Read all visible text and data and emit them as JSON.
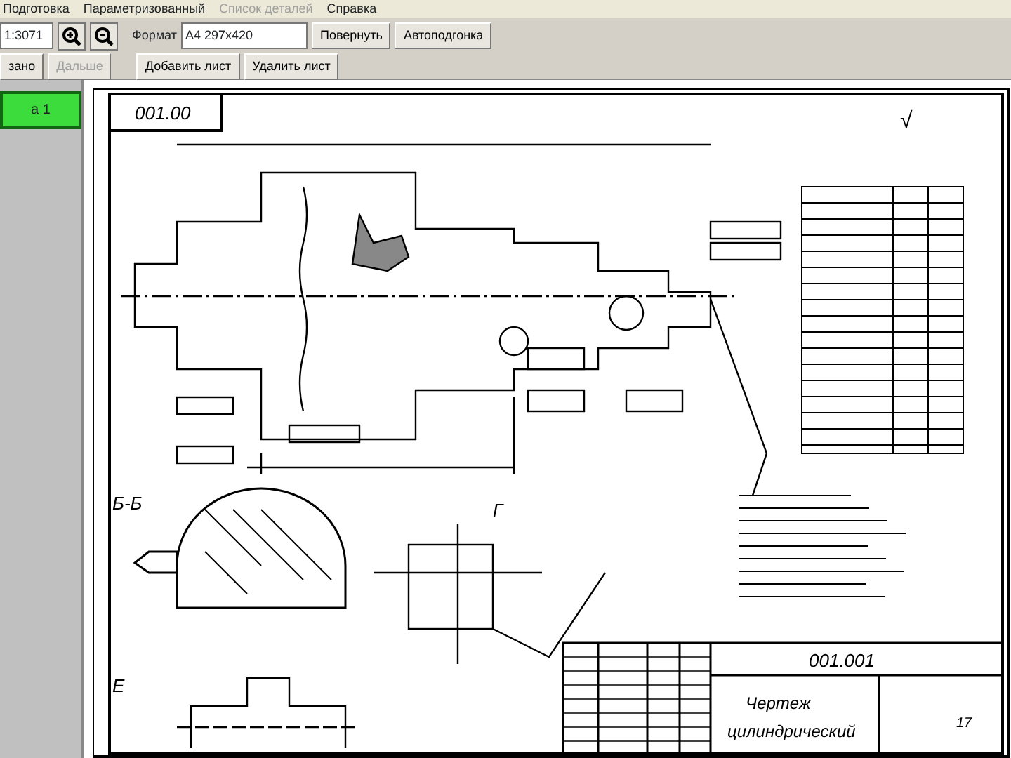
{
  "menu": [
    {
      "label": "Подготовка",
      "disabled": false
    },
    {
      "label": "Параметризованный",
      "disabled": false
    },
    {
      "label": "Список деталей",
      "disabled": true
    },
    {
      "label": "Справка",
      "disabled": false
    }
  ],
  "toolbar": {
    "scale": "1:3071",
    "format_label": "Формат",
    "format_value": "А4 297x420",
    "buttons_row1": [
      {
        "label": "Повернуть",
        "disabled": false
      },
      {
        "label": "Автоподгонка",
        "disabled": false
      }
    ],
    "buttons_row0": [
      {
        "label": "зано",
        "disabled": false
      },
      {
        "label": "Дальше",
        "disabled": true
      }
    ],
    "buttons_row2": [
      {
        "label": "Добавить лист",
        "disabled": false
      },
      {
        "label": "Удалить лист",
        "disabled": false
      }
    ]
  },
  "sheet_tab": {
    "label": "а 1",
    "selected": true
  },
  "drawing": {
    "stamp": "001.00",
    "section_b": "Б-Б",
    "view_g": "Г",
    "view_e": "Е",
    "roughness": "√",
    "title_code": "001.001",
    "title_name": "Чертеж",
    "title_sub": "цилиндрический",
    "sheet": "17"
  }
}
